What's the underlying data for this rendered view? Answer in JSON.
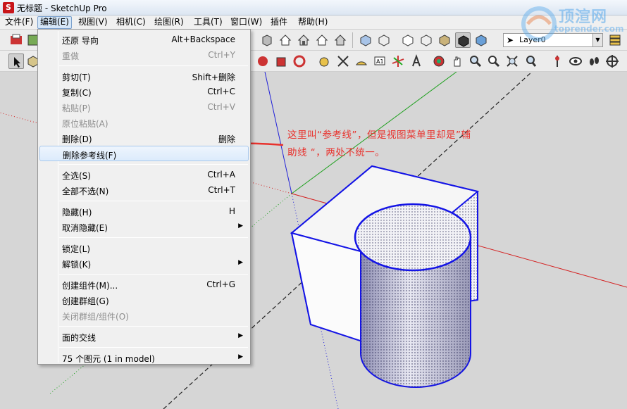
{
  "window": {
    "title": "无标题 - SketchUp Pro",
    "app_icon": "sketchup-logo-icon"
  },
  "menubar": {
    "items": [
      {
        "label": "文件(F)"
      },
      {
        "label": "编辑(E)"
      },
      {
        "label": "视图(V)"
      },
      {
        "label": "相机(C)"
      },
      {
        "label": "绘图(R)"
      },
      {
        "label": "工具(T)"
      },
      {
        "label": "窗口(W)"
      },
      {
        "label": "插件"
      },
      {
        "label": "帮助(H)"
      }
    ],
    "open_item": "编辑(E)"
  },
  "layer_toolbar": {
    "current_layer": "Layer0"
  },
  "watermark": {
    "text": "顶渲网",
    "url": "toprender.com"
  },
  "edit_menu": {
    "items": [
      {
        "label": "还原 导向",
        "shortcut": "Alt+Backspace",
        "enabled": true
      },
      {
        "label": "重做",
        "shortcut": "Ctrl+Y",
        "enabled": false
      },
      {
        "label": "剪切(T)",
        "shortcut": "Shift+删除",
        "enabled": true
      },
      {
        "label": "复制(C)",
        "shortcut": "Ctrl+C",
        "enabled": true
      },
      {
        "label": "粘贴(P)",
        "shortcut": "Ctrl+V",
        "enabled": false
      },
      {
        "label": "原位粘贴(A)",
        "shortcut": "",
        "enabled": false
      },
      {
        "label": "删除(D)",
        "shortcut": "删除",
        "enabled": true
      },
      {
        "label": "删除参考线(F)",
        "shortcut": "",
        "enabled": true,
        "highlighted": true
      },
      {
        "label": "全选(S)",
        "shortcut": "Ctrl+A",
        "enabled": true
      },
      {
        "label": "全部不选(N)",
        "shortcut": "Ctrl+T",
        "enabled": true
      },
      {
        "label": "隐藏(H)",
        "shortcut": "H",
        "enabled": true
      },
      {
        "label": "取消隐藏(E)",
        "shortcut": "",
        "enabled": true,
        "submenu": true
      },
      {
        "label": "锁定(L)",
        "shortcut": "",
        "enabled": true
      },
      {
        "label": "解锁(K)",
        "shortcut": "",
        "enabled": true,
        "submenu": true
      },
      {
        "label": "创建组件(M)...",
        "shortcut": "Ctrl+G",
        "enabled": true
      },
      {
        "label": "创建群组(G)",
        "shortcut": "",
        "enabled": true
      },
      {
        "label": "关闭群组/组件(O)",
        "shortcut": "",
        "enabled": false
      },
      {
        "label": "面的交线",
        "shortcut": "",
        "enabled": true,
        "submenu": true
      },
      {
        "label": "75 个图元 (1 in model)",
        "shortcut": "",
        "enabled": true,
        "submenu": true
      }
    ]
  },
  "annotation": {
    "line1": "这里叫“参考线”，但是视图菜单里却是”辅",
    "line2": "助线 “，两处不统一。",
    "color": "#e8322d"
  },
  "colors": {
    "axis_red": "#d42020",
    "axis_green": "#1ea01e",
    "axis_blue": "#2020d8",
    "selection_edge": "#1414e6"
  }
}
